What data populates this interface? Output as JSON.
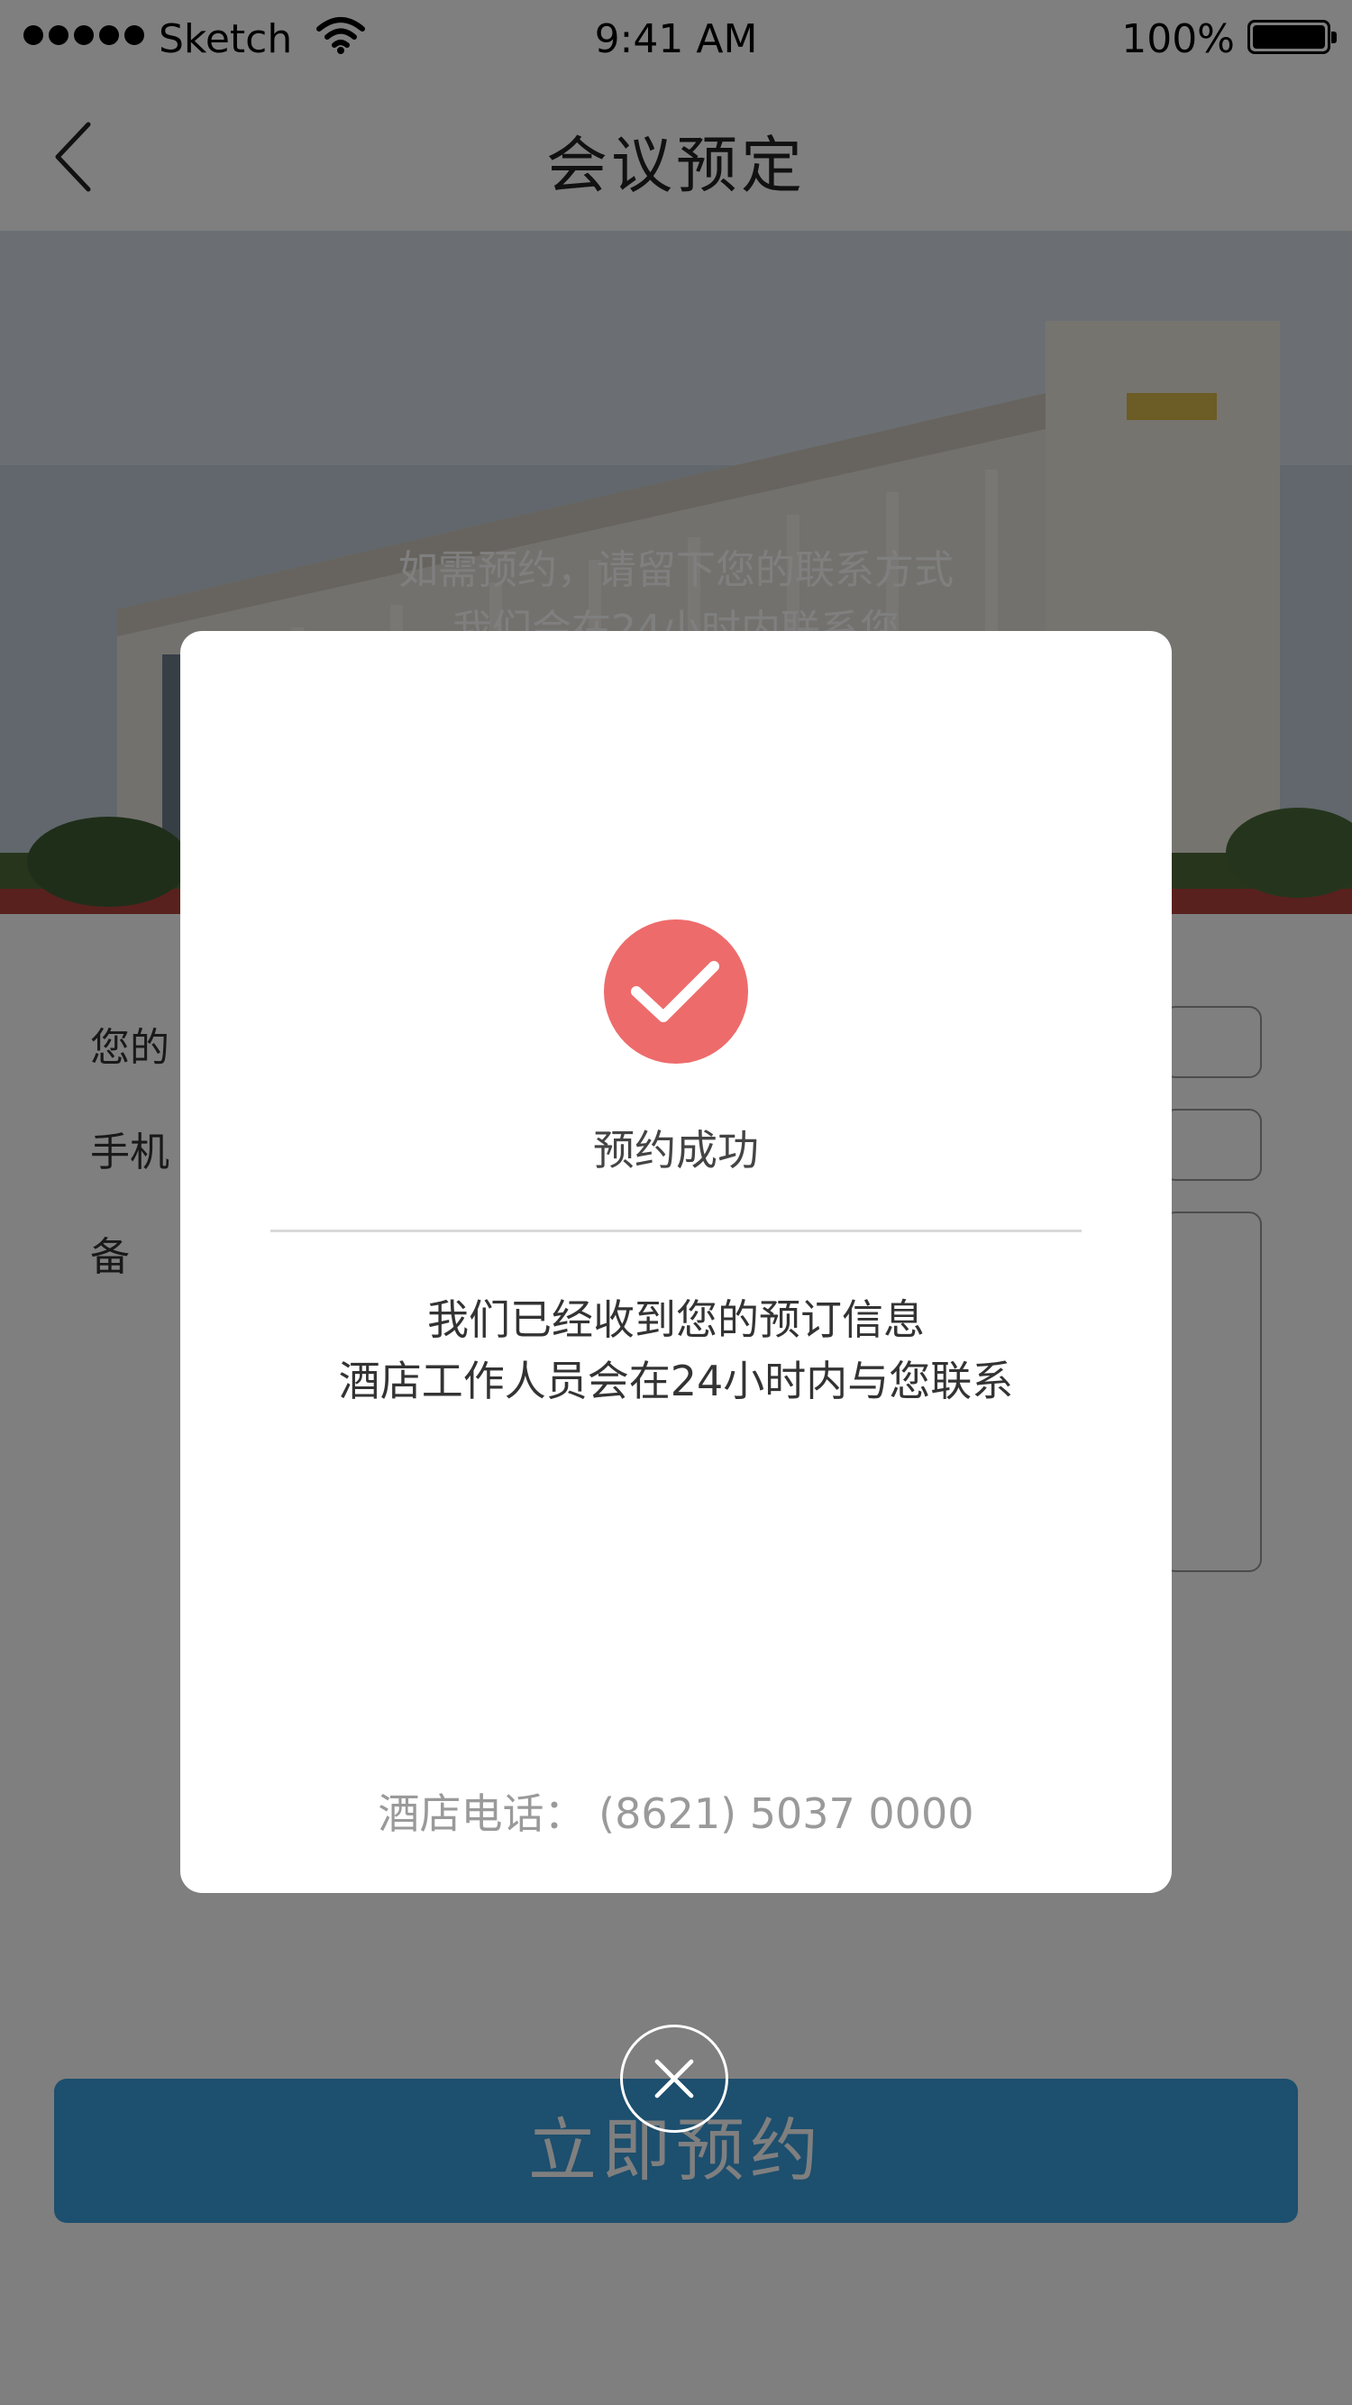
{
  "status_bar": {
    "carrier": "Sketch",
    "time": "9:41 AM",
    "battery_percent": "100%"
  },
  "nav": {
    "title": "会议预定",
    "back_icon": "chevron-left-icon"
  },
  "hero": {
    "line1": "如需预约，请留下您的联系方式",
    "line2": "我们会在24小时内联系您"
  },
  "form": {
    "name_label": "您的",
    "phone_label": "手机",
    "remark_label": "备"
  },
  "book_button_label": "立即预约",
  "modal": {
    "icon": "check-circle-icon",
    "icon_color": "#ee6b6b",
    "title": "预约成功",
    "message_line1": "我们已经收到您的预订信息",
    "message_line2": "酒店工作人员会在24小时内与您联系",
    "phone_label": "酒店电话：",
    "phone_number": "(8621) 5037 0000"
  },
  "close_icon": "close-icon",
  "accent_color": "#3b9fdc"
}
